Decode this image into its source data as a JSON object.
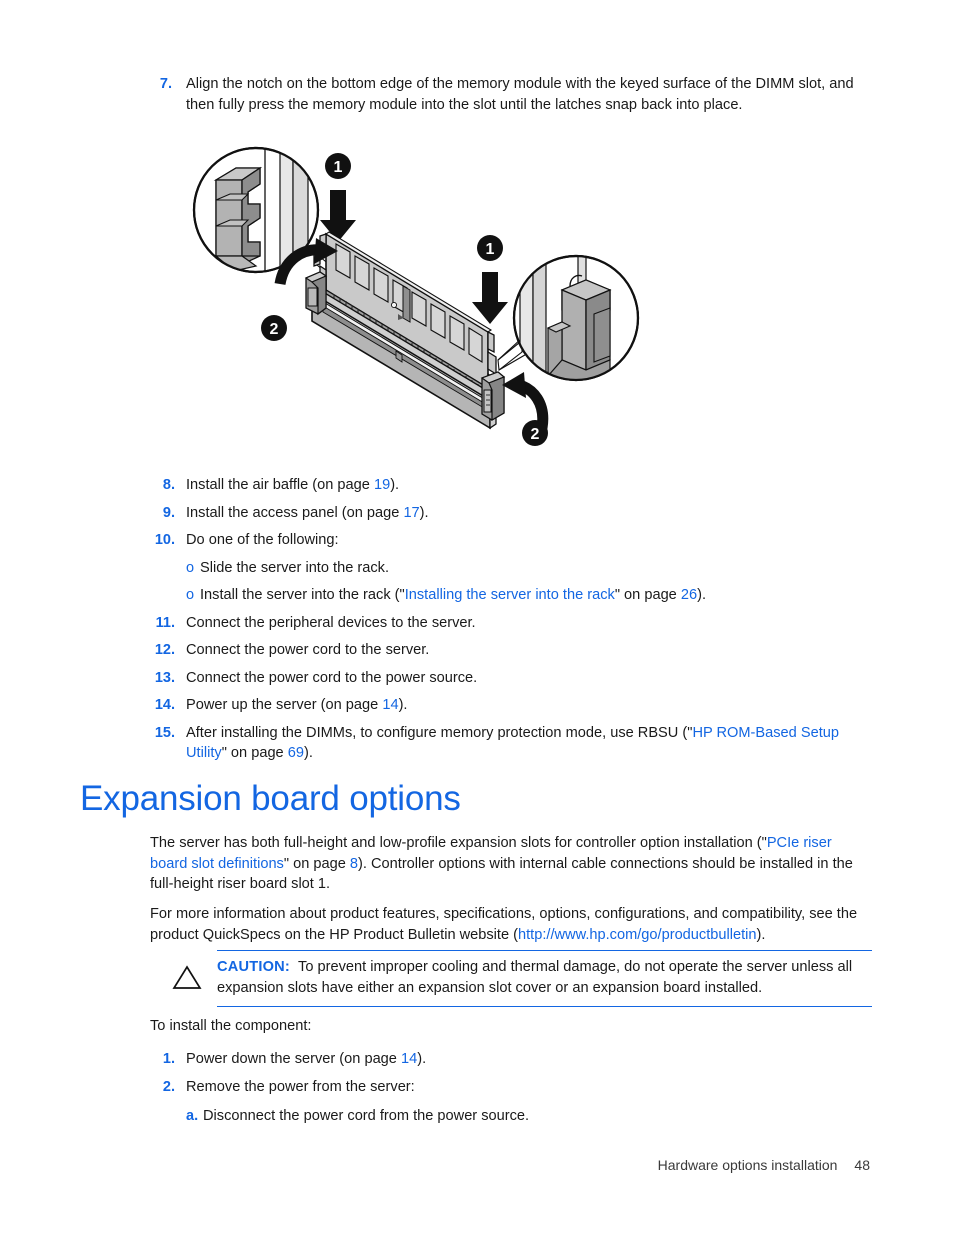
{
  "document": {
    "footer": {
      "chapter": "Hardware options installation",
      "page_number": "48"
    }
  },
  "steps_upper": [
    {
      "number": "7.",
      "text": "Align the notch on the bottom edge of the memory module with the keyed surface of the DIMM slot, and then fully press the memory module into the slot until the latches snap back into place."
    }
  ],
  "figure": {
    "alt": "Isometric illustration of a DIMM memory module being pressed into a DIMM slot with two magnified callout circles showing the latch detail",
    "callouts": [
      {
        "id": "1",
        "label": "1"
      },
      {
        "id": "1b",
        "label": "1"
      },
      {
        "id": "2",
        "label": "2"
      },
      {
        "id": "2b",
        "label": "2"
      }
    ]
  },
  "steps_lower": [
    {
      "number": "8.",
      "prefix": "Install the air baffle (on page ",
      "page": "19",
      "suffix": ")."
    },
    {
      "number": "9.",
      "prefix": "Install the access panel (on page ",
      "page": "17",
      "suffix": ")."
    },
    {
      "number": "10.",
      "prefix": "Do one of the following:",
      "page": "",
      "suffix": "",
      "subitems": [
        {
          "bullet": "o",
          "prefix": "Slide the server into the rack.",
          "link": "",
          "mid": "",
          "page": "",
          "suffix": ""
        },
        {
          "bullet": "o",
          "prefix": "Install the server into the rack (\"",
          "link": "Installing the server into the rack",
          "mid": "\" on page ",
          "page": "26",
          "suffix": ")."
        }
      ]
    },
    {
      "number": "11.",
      "prefix": "Connect the peripheral devices to the server.",
      "page": "",
      "suffix": ""
    },
    {
      "number": "12.",
      "prefix": "Connect the power cord to the server.",
      "page": "",
      "suffix": ""
    },
    {
      "number": "13.",
      "prefix": "Connect the power cord to the power source.",
      "page": "",
      "suffix": ""
    },
    {
      "number": "14.",
      "prefix": "Power up the server (on page ",
      "page": "14",
      "suffix": ")."
    },
    {
      "number": "15.",
      "prefix": "After installing the DIMMs, to configure memory protection mode, use RBSU (\"",
      "link": "HP ROM-Based Setup Utility",
      "mid": "\" on page ",
      "page": "69",
      "suffix": ")."
    }
  ],
  "section": {
    "title": "Expansion board options",
    "paragraph_1": {
      "part_1": "The server has both full-height and low-profile expansion slots for controller option installation (\"",
      "link": "PCIe riser board slot definitions",
      "part_2": "\" on page ",
      "page": "8",
      "part_3": "). Controller options with internal cable connections should be installed in the full-height riser board slot 1."
    },
    "paragraph_2": {
      "part_1": "For more information about product features, specifications, options, configurations, and compatibility, see the product QuickSpecs on the HP Product Bulletin website (",
      "link": "http://www.hp.com/go/productbulletin",
      "part_2": ")."
    },
    "caution": {
      "icon": "warning-triangle-icon",
      "label": "CAUTION:",
      "text": "To prevent improper cooling and thermal damage, do not operate the server unless all expansion slots have either an expansion slot cover or an expansion board installed."
    },
    "intro": "To install the component:",
    "install_steps": [
      {
        "number": "1.",
        "prefix": "Power down the server (on page ",
        "page": "14",
        "suffix": ")."
      },
      {
        "number": "2.",
        "prefix": "Remove the power from the server:",
        "page": "",
        "suffix": "",
        "alpha_items": [
          {
            "marker": "a.",
            "text": "Disconnect the power cord from the power source."
          }
        ]
      }
    ]
  },
  "colors": {
    "link": "#1366E2",
    "heading": "#1366E2",
    "text": "#1a1a1a",
    "rule": "#1366E2"
  }
}
